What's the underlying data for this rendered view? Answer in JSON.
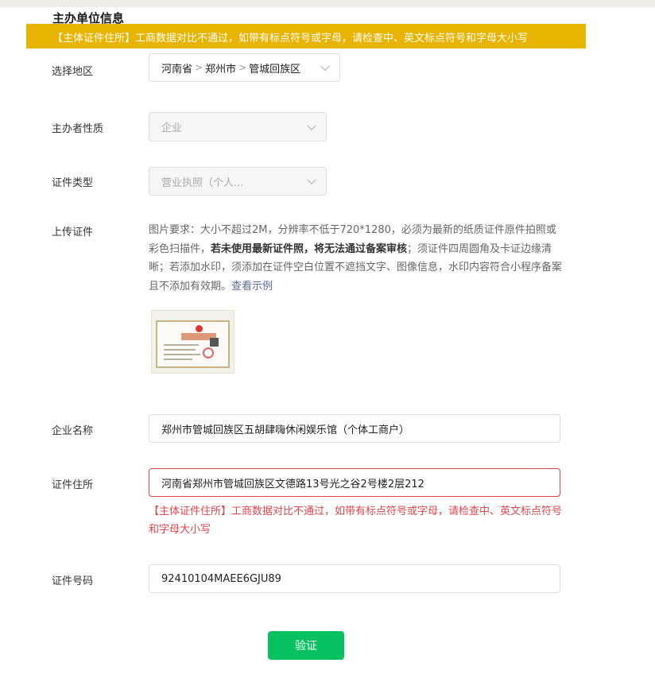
{
  "section_title": "主办单位信息",
  "banner_text": "【主体证件住所】工商数据对比不通过，如带有标点符号或字母，请检查中、英文标点符号和字母大小写",
  "region": {
    "label": "选择地区",
    "province": "河南省",
    "city": "郑州市",
    "district": "管城回族区",
    "separator": ">"
  },
  "sponsor_nature": {
    "label": "主办者性质",
    "value": "企业"
  },
  "cert_type": {
    "label": "证件类型",
    "value": "营业执照（个人..."
  },
  "upload": {
    "label": "上传证件",
    "desc_part1": "图片要求：大小不超过2M，分辨率不低于720*1280，必须为最新的纸质证件原件拍照或彩色扫描件，",
    "desc_bold": "若未使用最新证件照，将无法通过备案审核",
    "desc_part2": "；须证件四周圆角及卡证边缘清晰；若添加水印，须添加在证件空白位置不遮挡文字、图像信息，水印内容符合小程序备案且不添加有效期。",
    "example_link": "查看示例",
    "thumbnail_title": "营业执照"
  },
  "company_name": {
    "label": "企业名称",
    "value": "郑州市管城回族区五胡肆嗨休闲娱乐馆（个体工商户）"
  },
  "cert_address": {
    "label": "证件住所",
    "value": "河南省郑州市管城回族区文德路13号光之谷2号楼2层212",
    "error": "【主体证件住所】工商数据对比不通过，如带有标点符号或字母，请检查中、英文标点符号和字母大小写"
  },
  "cert_number": {
    "label": "证件号码",
    "value": "92410104MAEE6GJU89"
  },
  "verify_button": "验证",
  "colors": {
    "warning": "#e8b400",
    "error": "#e0464b",
    "primary": "#07c160",
    "link": "#576b95"
  }
}
